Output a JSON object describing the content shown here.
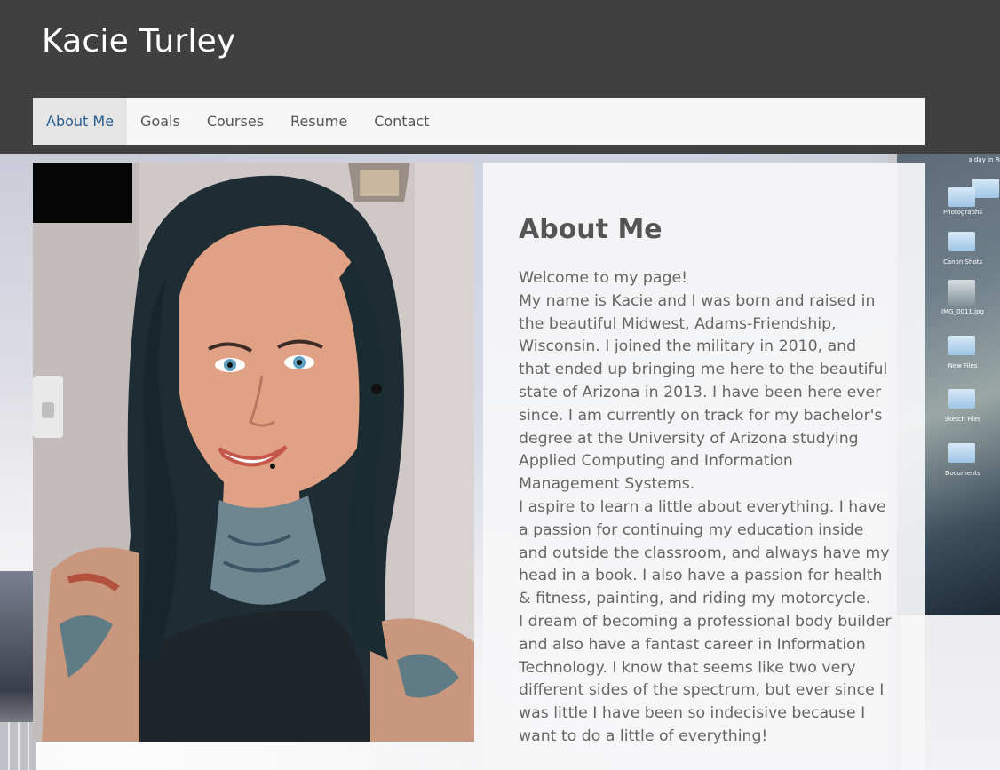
{
  "site": {
    "title": "Kacie Turley"
  },
  "nav": {
    "items": [
      {
        "label": "About Me",
        "active": true
      },
      {
        "label": "Goals",
        "active": false
      },
      {
        "label": "Courses",
        "active": false
      },
      {
        "label": "Resume",
        "active": false
      },
      {
        "label": "Contact",
        "active": false
      }
    ]
  },
  "background": {
    "desktop_folders": [
      "a day in Ro",
      "Photographs",
      "Canon Shots",
      "IMG_0011.jpg",
      "New Files",
      "Sketch Files",
      "Documents"
    ]
  },
  "about": {
    "heading": "About Me",
    "paragraphs": [
      "Welcome to my page!",
      "My name is Kacie and I was born and raised in the beautiful Midwest, Adams-Friendship, Wisconsin. I joined the military in 2010, and that ended up bringing me here to the beautiful state of Arizona in 2013. I have been here ever since. I am currently on track for my bachelor's degree at the University of Arizona studying Applied Computing and Information Management Systems.",
      "I aspire to learn a little about everything. I have a passion for continuing my education inside and outside the classroom, and always have my head in a book. I also have a passion for health & fitness, painting, and riding my motorcycle.",
      "I dream of becoming a professional body builder and also have a fantast career in Information Technology. I know that seems like two very different sides of the spectrum, but ever since I was little I have been so indecisive because I want to do a little of everything!"
    ]
  },
  "colors": {
    "header_bg": "#404040",
    "nav_bg": "#f7f7f7",
    "nav_active_bg": "#e5e5e5",
    "nav_active_text": "#2a5d8f"
  }
}
